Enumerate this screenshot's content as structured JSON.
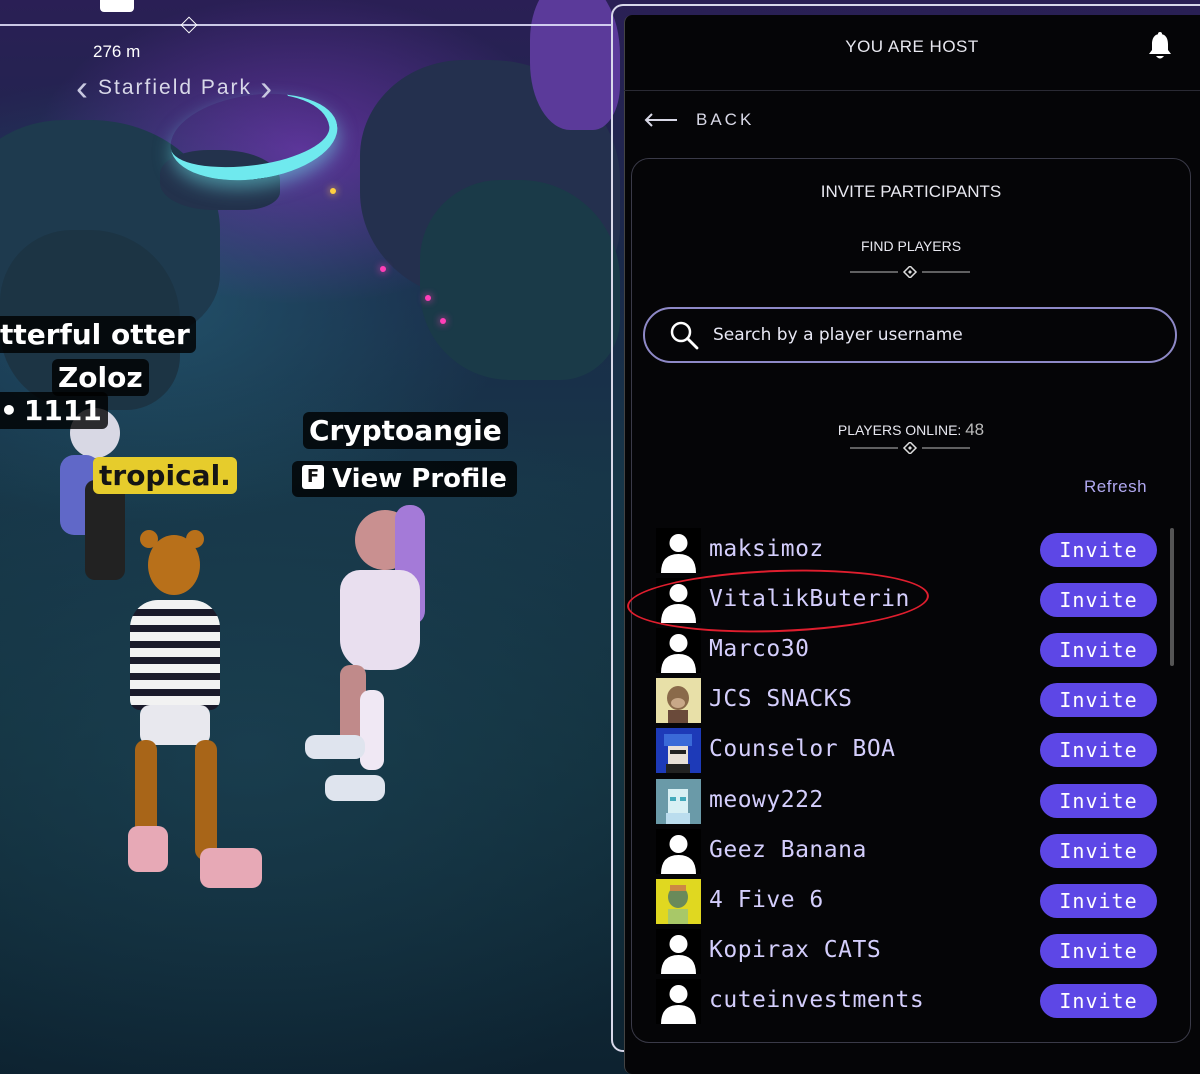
{
  "hud": {
    "distance": "276 m",
    "location": "Starfield Park"
  },
  "name_tags": {
    "otter": "tterful otter",
    "zoloz": "Zoloz",
    "n1111": "1111",
    "tropical": "tropical.",
    "cryptoangie": "Cryptoangie",
    "view_profile_key": "F",
    "view_profile": "View Profile"
  },
  "panel": {
    "host_label": "YOU ARE HOST",
    "back_label": "BACK",
    "invite_title": "INVITE PARTICIPANTS",
    "find_players": "FIND PLAYERS",
    "search_placeholder": "Search by a player username",
    "players_online_label": "PLAYERS ONLINE:",
    "players_online_count": "48",
    "refresh_label": "Refresh",
    "invite_label": "Invite",
    "players": [
      {
        "name": "maksimoz",
        "avatar": "default"
      },
      {
        "name": "VitalikButerin",
        "avatar": "default",
        "circled": true
      },
      {
        "name": "Marco30",
        "avatar": "default"
      },
      {
        "name": "JCS SNACKS",
        "avatar": "ape-nft"
      },
      {
        "name": "Counselor BOA",
        "avatar": "blue-hair-pixel"
      },
      {
        "name": "meowy222",
        "avatar": "cyan-pixel"
      },
      {
        "name": "Geez Banana",
        "avatar": "default"
      },
      {
        "name": "4 Five 6",
        "avatar": "yellow-nft"
      },
      {
        "name": "Kopirax CATS",
        "avatar": "default"
      },
      {
        "name": "cuteinvestments",
        "avatar": "default"
      }
    ]
  },
  "colors": {
    "invite_button": "#5d47e6",
    "player_name": "#d4cefc",
    "annotation_circle": "#e01e2e",
    "panel_bg": "#050507"
  }
}
